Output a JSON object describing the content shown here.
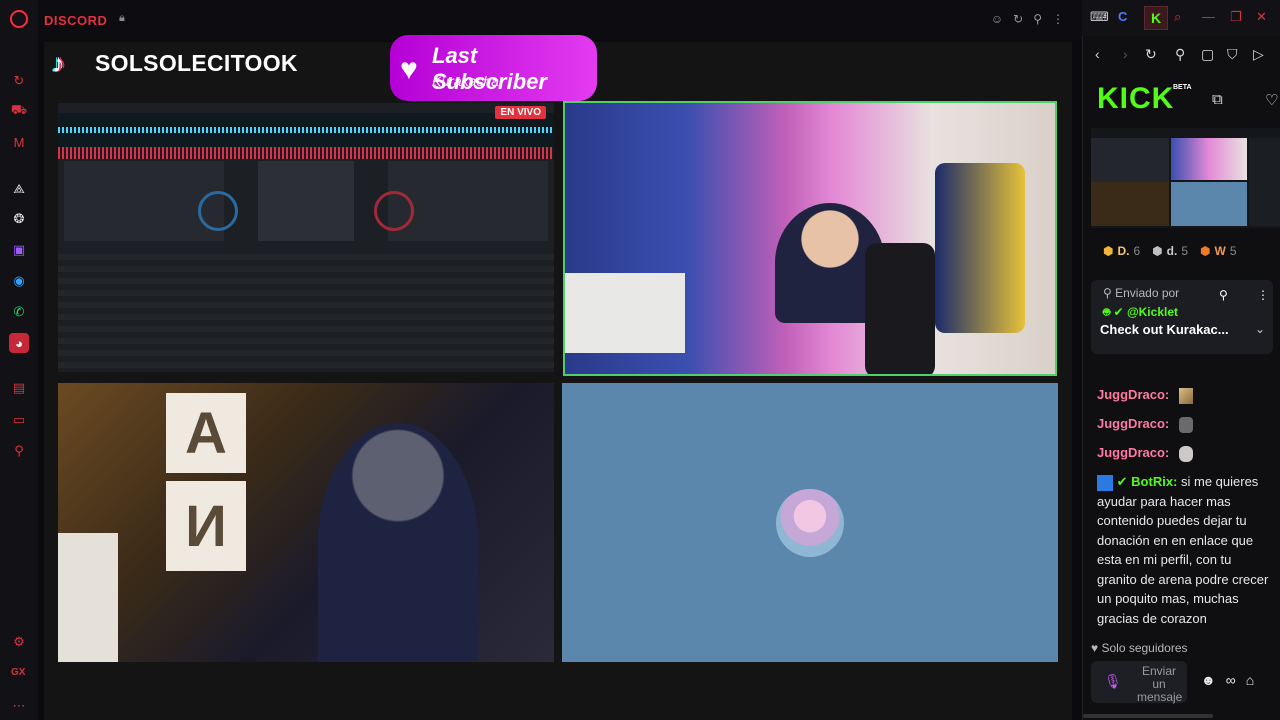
{
  "topbar": {
    "brand": "DISCORD",
    "lock_icon": "lock-icon"
  },
  "stream": {
    "channel_name": "SOLSOLECITOOK",
    "subscriber_title": "Last Subscriber",
    "subscriber_name": "Kurakacha",
    "live_badge": "EN VIVO",
    "card_letter_a": "A",
    "card_letter_n": "И"
  },
  "kick": {
    "logo": "KICK",
    "beta": "BETA",
    "badges": [
      {
        "label": "D.",
        "count": "6"
      },
      {
        "label": "d.",
        "count": "5"
      },
      {
        "label": "W",
        "count": "5"
      }
    ],
    "pinned": {
      "sent_by": "Enviado por",
      "user": "@Kicklet",
      "message": "Check out Kurakac..."
    },
    "chat": [
      {
        "user": "JuggDraco:",
        "text": ""
      },
      {
        "user": "JuggDraco:",
        "text": ""
      },
      {
        "user": "JuggDraco:",
        "text": ""
      },
      {
        "user": "BotRix:",
        "text": "si me quieres ayudar para hacer mas contenido puedes dejar tu donación en en enlace que esta en mi perfil, con tu granito de arena podre crecer un poquito mas, muchas gracias de corazon"
      }
    ],
    "followers_only": "Solo seguidores",
    "input_placeholder": "Enviar un mensaje"
  },
  "colors": {
    "accent": "#e0323f",
    "kick_green": "#53fc18",
    "sub_purple": "#c40fe0"
  }
}
